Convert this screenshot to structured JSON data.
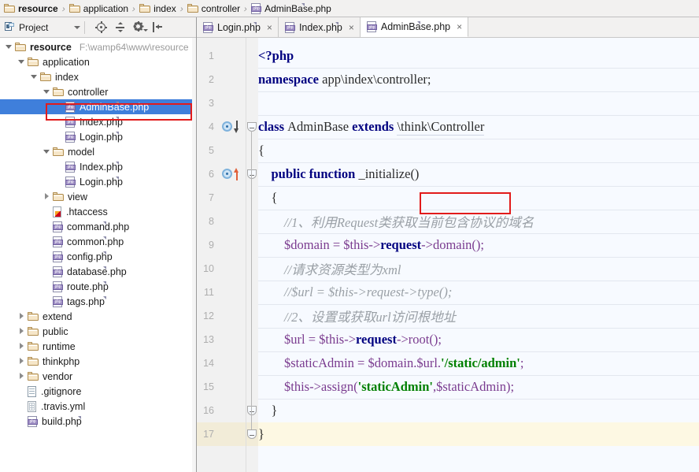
{
  "breadcrumb": {
    "items": [
      {
        "label": "resource",
        "icon": "folder-icon",
        "bold": true
      },
      {
        "label": "application",
        "icon": "folder-icon",
        "bold": false
      },
      {
        "label": "index",
        "icon": "folder-icon",
        "bold": false
      },
      {
        "label": "controller",
        "icon": "folder-icon",
        "bold": false
      },
      {
        "label": "AdminBase.php",
        "icon": "php-file-icon",
        "bold": false
      }
    ],
    "separator": "›"
  },
  "panel": {
    "title": "Project",
    "toolbar": [
      {
        "name": "locate-in-tree-icon",
        "label": "Select Opened File"
      },
      {
        "name": "collapse-all-icon",
        "label": "Collapse All"
      },
      {
        "name": "settings-gear-icon",
        "label": "Settings"
      },
      {
        "name": "hide-panel-icon",
        "label": "Hide"
      }
    ]
  },
  "tree": [
    {
      "label": "resource",
      "path": "F:\\wamp64\\www\\resource",
      "icon": "folder-icon",
      "twist": "down",
      "indent": 0,
      "bold": true,
      "selected": false
    },
    {
      "label": "application",
      "path": "",
      "icon": "folder-icon",
      "twist": "down",
      "indent": 1,
      "bold": false,
      "selected": false
    },
    {
      "label": "index",
      "path": "",
      "icon": "folder-icon",
      "twist": "down",
      "indent": 2,
      "bold": false,
      "selected": false
    },
    {
      "label": "controller",
      "path": "",
      "icon": "folder-icon",
      "twist": "down",
      "indent": 3,
      "bold": false,
      "selected": false
    },
    {
      "label": "AdminBase.php",
      "path": "",
      "icon": "php-file-icon",
      "twist": "none",
      "indent": 4,
      "bold": false,
      "selected": true
    },
    {
      "label": "Index.php",
      "path": "",
      "icon": "php-file-icon",
      "twist": "none",
      "indent": 4,
      "bold": false,
      "selected": false
    },
    {
      "label": "Login.php",
      "path": "",
      "icon": "php-file-icon",
      "twist": "none",
      "indent": 4,
      "bold": false,
      "selected": false
    },
    {
      "label": "model",
      "path": "",
      "icon": "folder-icon",
      "twist": "down",
      "indent": 3,
      "bold": false,
      "selected": false
    },
    {
      "label": "Index.php",
      "path": "",
      "icon": "php-file-icon",
      "twist": "none",
      "indent": 4,
      "bold": false,
      "selected": false
    },
    {
      "label": "Login.php",
      "path": "",
      "icon": "php-file-icon",
      "twist": "none",
      "indent": 4,
      "bold": false,
      "selected": false
    },
    {
      "label": "view",
      "path": "",
      "icon": "folder-icon",
      "twist": "right",
      "indent": 3,
      "bold": false,
      "selected": false
    },
    {
      "label": ".htaccess",
      "path": "",
      "icon": "htaccess-file-icon",
      "twist": "none",
      "indent": 3,
      "bold": false,
      "selected": false
    },
    {
      "label": "command.php",
      "path": "",
      "icon": "php-file-icon",
      "twist": "none",
      "indent": 3,
      "bold": false,
      "selected": false
    },
    {
      "label": "common.php",
      "path": "",
      "icon": "php-file-icon",
      "twist": "none",
      "indent": 3,
      "bold": false,
      "selected": false
    },
    {
      "label": "config.php",
      "path": "",
      "icon": "php-file-icon",
      "twist": "none",
      "indent": 3,
      "bold": false,
      "selected": false
    },
    {
      "label": "database.php",
      "path": "",
      "icon": "php-file-icon",
      "twist": "none",
      "indent": 3,
      "bold": false,
      "selected": false
    },
    {
      "label": "route.php",
      "path": "",
      "icon": "php-file-icon",
      "twist": "none",
      "indent": 3,
      "bold": false,
      "selected": false
    },
    {
      "label": "tags.php",
      "path": "",
      "icon": "php-file-icon",
      "twist": "none",
      "indent": 3,
      "bold": false,
      "selected": false
    },
    {
      "label": "extend",
      "path": "",
      "icon": "folder-icon",
      "twist": "right",
      "indent": 1,
      "bold": false,
      "selected": false
    },
    {
      "label": "public",
      "path": "",
      "icon": "folder-icon",
      "twist": "right",
      "indent": 1,
      "bold": false,
      "selected": false
    },
    {
      "label": "runtime",
      "path": "",
      "icon": "folder-icon",
      "twist": "right",
      "indent": 1,
      "bold": false,
      "selected": false
    },
    {
      "label": "thinkphp",
      "path": "",
      "icon": "folder-icon",
      "twist": "right",
      "indent": 1,
      "bold": false,
      "selected": false
    },
    {
      "label": "vendor",
      "path": "",
      "icon": "folder-icon",
      "twist": "right",
      "indent": 1,
      "bold": false,
      "selected": false
    },
    {
      "label": ".gitignore",
      "path": "",
      "icon": "text-file-icon",
      "twist": "none",
      "indent": 1,
      "bold": false,
      "selected": false
    },
    {
      "label": ".travis.yml",
      "path": "",
      "icon": "yml-file-icon",
      "twist": "none",
      "indent": 1,
      "bold": false,
      "selected": false
    },
    {
      "label": "build.php",
      "path": "",
      "icon": "php-file-icon",
      "twist": "none",
      "indent": 1,
      "bold": false,
      "selected": false
    }
  ],
  "editor_tabs": [
    {
      "label": "Login.php",
      "icon": "php-file-icon",
      "close": "×",
      "active": false
    },
    {
      "label": "Index.php",
      "icon": "php-file-icon",
      "close": "×",
      "active": false
    },
    {
      "label": "AdminBase.php",
      "icon": "php-file-icon",
      "close": "×",
      "active": true
    }
  ],
  "code": {
    "file": "AdminBase.php",
    "caret_line": 17,
    "lines": [
      {
        "n": 1,
        "tokens": [
          {
            "t": "<?php",
            "c": "k"
          }
        ]
      },
      {
        "n": 2,
        "tokens": [
          {
            "t": "namespace ",
            "c": "k"
          },
          {
            "t": "app\\index\\controller;",
            "c": "pl"
          }
        ]
      },
      {
        "n": 3,
        "tokens": []
      },
      {
        "n": 4,
        "tokens": [
          {
            "t": "class ",
            "c": "k"
          },
          {
            "t": "AdminBase ",
            "c": "pl"
          },
          {
            "t": "extends ",
            "c": "k"
          },
          {
            "t": "\\think\\Controller",
            "c": "inh"
          }
        ]
      },
      {
        "n": 5,
        "tokens": [
          {
            "t": "{",
            "c": "pl"
          }
        ]
      },
      {
        "n": 6,
        "tokens": [
          {
            "t": "    public function ",
            "c": "k"
          },
          {
            "t": "_initialize",
            "c": "pl"
          },
          {
            "t": "()",
            "c": "pl"
          }
        ]
      },
      {
        "n": 7,
        "tokens": [
          {
            "t": "    {",
            "c": "pl"
          }
        ]
      },
      {
        "n": 8,
        "tokens": [
          {
            "t": "        //1、利用Request类获取当前包含协议的域名",
            "c": "cm"
          }
        ]
      },
      {
        "n": 9,
        "tokens": [
          {
            "t": "        $domain = $this->",
            "c": "var"
          },
          {
            "t": "request",
            "c": "mth"
          },
          {
            "t": "->domain();",
            "c": "var"
          }
        ]
      },
      {
        "n": 10,
        "tokens": [
          {
            "t": "        //请求资源类型为xml",
            "c": "cm"
          }
        ]
      },
      {
        "n": 11,
        "tokens": [
          {
            "t": "        //$url = $this->request->type();",
            "c": "cm"
          }
        ]
      },
      {
        "n": 12,
        "tokens": [
          {
            "t": "        //2、设置或获取url访问根地址",
            "c": "cm"
          }
        ]
      },
      {
        "n": 13,
        "tokens": [
          {
            "t": "        $url = $this->",
            "c": "var"
          },
          {
            "t": "request",
            "c": "mth"
          },
          {
            "t": "->root();",
            "c": "var"
          }
        ]
      },
      {
        "n": 14,
        "tokens": [
          {
            "t": "        $staticAdmin = $domain.$url.",
            "c": "var"
          },
          {
            "t": "'/static/admin'",
            "c": "str"
          },
          {
            "t": ";",
            "c": "var"
          }
        ]
      },
      {
        "n": 15,
        "tokens": [
          {
            "t": "        $this->assign(",
            "c": "var"
          },
          {
            "t": "'staticAdmin'",
            "c": "str"
          },
          {
            "t": ",$staticAdmin);",
            "c": "var"
          }
        ]
      },
      {
        "n": 16,
        "tokens": [
          {
            "t": "    }",
            "c": "pl"
          }
        ]
      },
      {
        "n": 17,
        "tokens": [
          {
            "t": "}",
            "c": "pl"
          }
        ]
      }
    ],
    "gutter_markers": [
      {
        "line": 4,
        "name": "overridden-method-marker",
        "direction": "down"
      },
      {
        "line": 6,
        "name": "overriding-method-marker",
        "direction": "up"
      }
    ],
    "fold_marks": [
      4,
      6,
      16,
      17
    ]
  },
  "annotations": [
    {
      "name": "highlight-adminbase-tree-item",
      "target": "AdminBase.php",
      "color": "#e21b1b"
    },
    {
      "name": "highlight-initialize-method",
      "target": "_initialize",
      "color": "#e21b1b"
    }
  ],
  "colors": {
    "selection_blue": "#3f7fdb",
    "annotation_red": "#e21b1b",
    "editor_bg": "#f7faff",
    "caret_line": "#fdf8e3",
    "keyword": "#000080",
    "string": "#008000",
    "comment": "#9aa0a6",
    "variable": "#7a3b8f"
  }
}
